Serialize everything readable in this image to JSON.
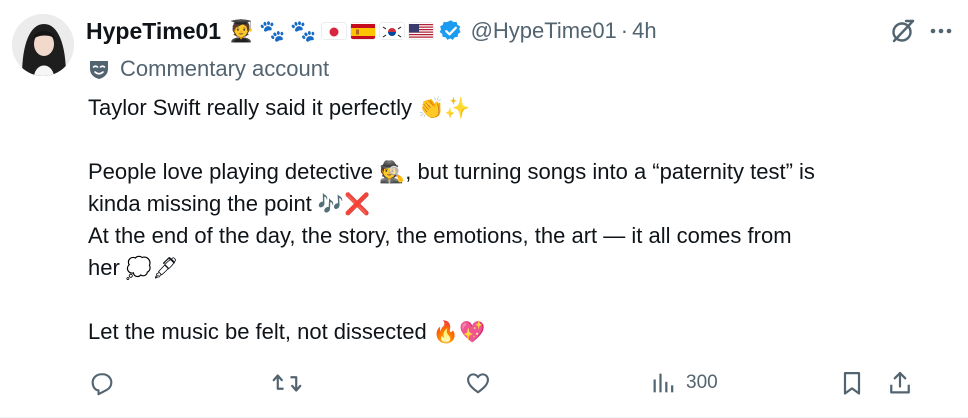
{
  "author": {
    "display_name": "HypeTime01",
    "name_emojis": [
      "🧑‍🎓",
      "🐾",
      "🐾"
    ],
    "flags": [
      "japan-flag",
      "spain-flag",
      "south-korea-flag",
      "usa-flag"
    ],
    "verified": true,
    "handle": "@HypeTime01",
    "separator": "·",
    "time": "4h"
  },
  "label": {
    "text": "Commentary account",
    "icon": "theater-mask-icon"
  },
  "body": {
    "line1": "Taylor Swift really said it perfectly",
    "line1_emoji": "👏✨",
    "line2_a": "People love playing detective",
    "line2_emoji": "🕵",
    "line2_b": ", but turning songs into a “paternity test” is",
    "line3": "kinda missing the point",
    "line3_emoji": "🎶❌",
    "line4": "At the end of the day, the story, the emotions, the art — it all comes from",
    "line5": "her",
    "line5_emoji": "💭🖋",
    "line6": "Let the music be felt, not dissected",
    "line6_emoji": "🔥💖"
  },
  "actions": {
    "reply_icon": "reply-icon",
    "retweet_icon": "retweet-icon",
    "like_icon": "like-icon",
    "views_icon": "views-icon",
    "views_count": "300",
    "bookmark_icon": "bookmark-icon",
    "share_icon": "share-icon"
  },
  "colors": {
    "text": "#0f1419",
    "secondary": "#536471",
    "verified": "#1d9bf0"
  }
}
